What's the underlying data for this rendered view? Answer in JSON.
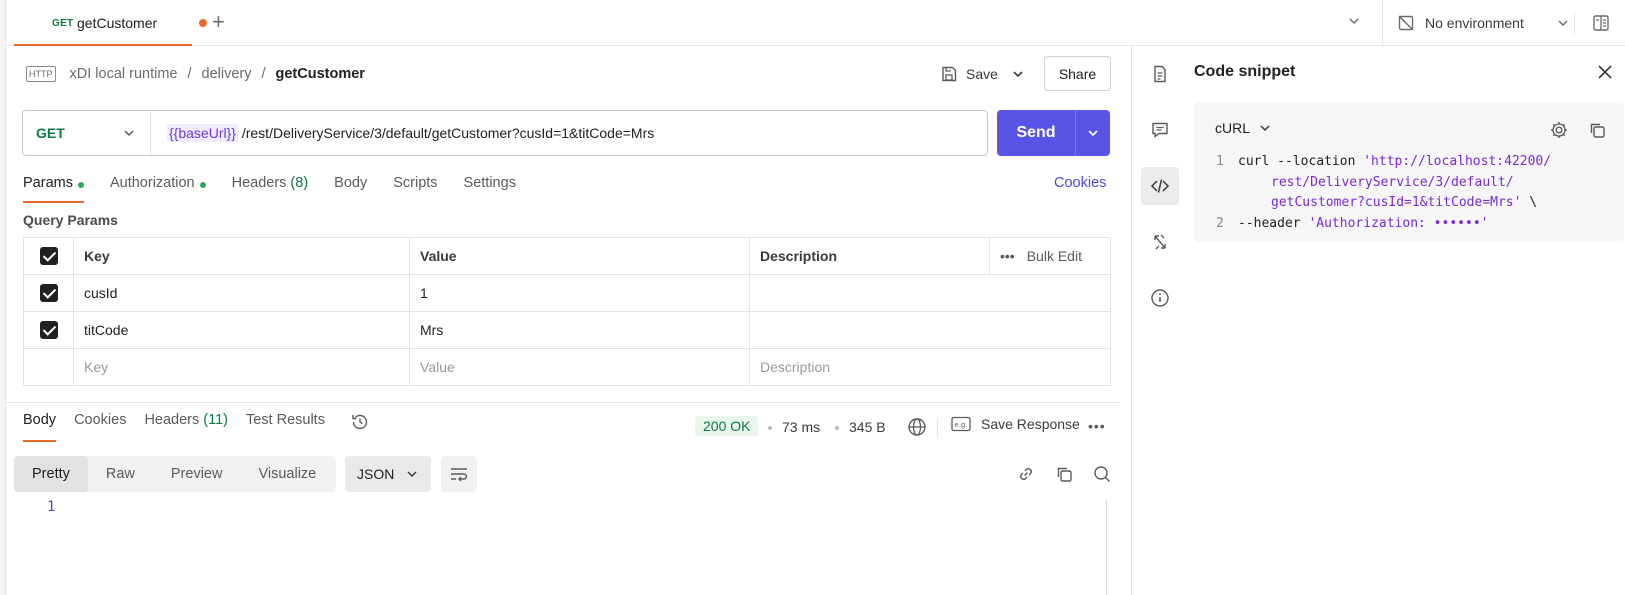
{
  "tab": {
    "method": "GET",
    "name": "getCustomer"
  },
  "environment": {
    "label": "No environment"
  },
  "breadcrumb": {
    "icon_text": "HTTP",
    "collection": "xDI local runtime",
    "folder": "delivery",
    "request": "getCustomer",
    "sep": "/"
  },
  "actions": {
    "save": "Save",
    "share": "Share"
  },
  "request": {
    "method": "GET",
    "url_var": "{{baseUrl}}",
    "url_path": " /rest/DeliveryService/3/default/getCustomer?cusId=1&titCode=Mrs",
    "send": "Send"
  },
  "req_tabs": {
    "params": "Params",
    "authorization": "Authorization",
    "headers": "Headers",
    "headers_count": "(8)",
    "body": "Body",
    "scripts": "Scripts",
    "settings": "Settings",
    "cookies": "Cookies"
  },
  "query_params": {
    "title": "Query Params",
    "columns": {
      "key": "Key",
      "value": "Value",
      "description": "Description",
      "bulk_edit": "Bulk Edit"
    },
    "rows": [
      {
        "key": "cusId",
        "value": "1",
        "description": ""
      },
      {
        "key": "titCode",
        "value": "Mrs",
        "description": ""
      }
    ],
    "placeholder": {
      "key": "Key",
      "value": "Value",
      "description": "Description"
    }
  },
  "response": {
    "tabs": {
      "body": "Body",
      "cookies": "Cookies",
      "headers": "Headers",
      "headers_count": "(11)",
      "tests": "Test Results"
    },
    "status": "200 OK",
    "time": "73 ms",
    "size": "345 B",
    "save_response": "Save Response",
    "views": [
      "Pretty",
      "Raw",
      "Preview",
      "Visualize"
    ],
    "format": "JSON",
    "line_number": "1"
  },
  "side_panel": {
    "title": "Code snippet",
    "language": "cURL",
    "code": {
      "l1_num": "1",
      "l1_cmd": "curl --location ",
      "l1_str": "'http://localhost:42200/",
      "l1b_str": "rest/DeliveryService/3/default/",
      "l1c_str": "getCustomer?cusId=1&titCode=Mrs'",
      "l1c_tail": " \\",
      "l2_num": "2",
      "l2_cmd": "--header ",
      "l2_str": "'Authorization: ••••••'"
    }
  },
  "colors": {
    "accent_orange": "#e86b2d",
    "send_button": "#5a54e6",
    "method_green": "#0a7a3d",
    "link_blue": "#4a4ad8",
    "string_purple": "#7a2bd1"
  }
}
